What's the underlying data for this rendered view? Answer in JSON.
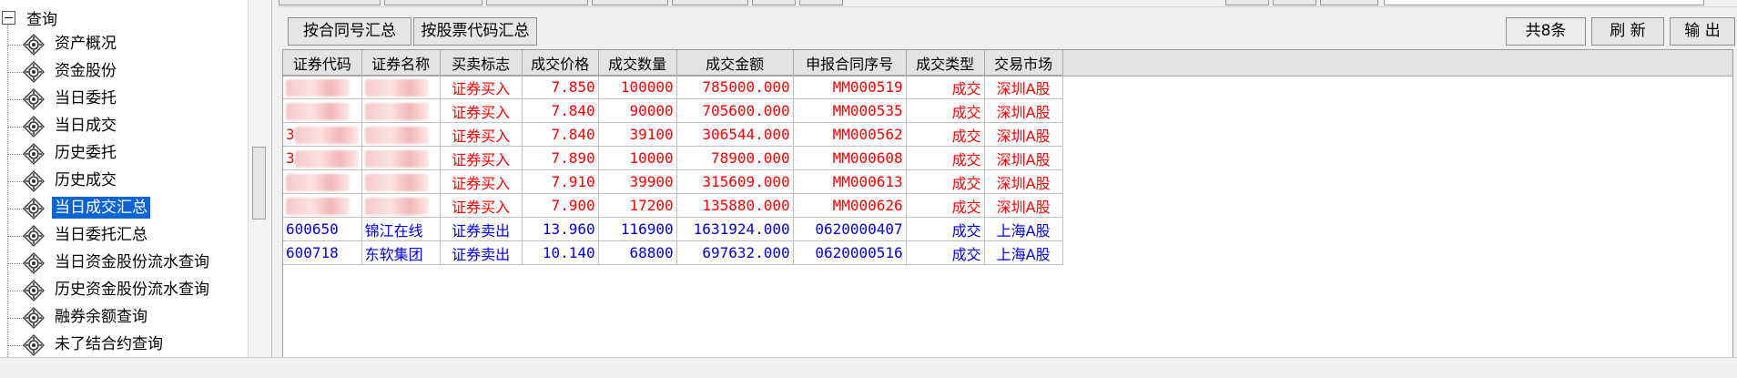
{
  "tree": {
    "root_label": "查询",
    "items": [
      {
        "label": "资产概况",
        "selected": false
      },
      {
        "label": "资金股份",
        "selected": false
      },
      {
        "label": "当日委托",
        "selected": false
      },
      {
        "label": "当日成交",
        "selected": false
      },
      {
        "label": "历史委托",
        "selected": false
      },
      {
        "label": "历史成交",
        "selected": false
      },
      {
        "label": "当日成交汇总",
        "selected": true
      },
      {
        "label": "当日委托汇总",
        "selected": false
      },
      {
        "label": "当日资金股份流水查询",
        "selected": false
      },
      {
        "label": "历史资金股份流水查询",
        "selected": false
      },
      {
        "label": "融券余额查询",
        "selected": false
      },
      {
        "label": "未了结合约查询",
        "selected": false
      }
    ]
  },
  "toolbar": {
    "group_by_contract": "按合同号汇总",
    "group_by_code": "按股票代码汇总",
    "count": "共8条",
    "refresh": "刷 新",
    "export": "输 出"
  },
  "table": {
    "columns": [
      "证券代码",
      "证券名称",
      "买卖标志",
      "成交价格",
      "成交数量",
      "成交金额",
      "申报合同序号",
      "成交类型",
      "交易市场"
    ],
    "rows": [
      {
        "code": "",
        "name": "",
        "side": "证券买入",
        "price": "7.850",
        "qty": "100000",
        "amount": "785000.000",
        "contract": "MM000519",
        "type": "成交",
        "market": "深圳A股",
        "color": "red",
        "redacted": true
      },
      {
        "code": "",
        "name": "",
        "side": "证券买入",
        "price": "7.840",
        "qty": "90000",
        "amount": "705600.000",
        "contract": "MM000535",
        "type": "成交",
        "market": "深圳A股",
        "color": "red",
        "redacted": true
      },
      {
        "code": "3",
        "name": "",
        "side": "证券买入",
        "price": "7.840",
        "qty": "39100",
        "amount": "306544.000",
        "contract": "MM000562",
        "type": "成交",
        "market": "深圳A股",
        "color": "red",
        "redacted": true
      },
      {
        "code": "3",
        "name": "",
        "side": "证券买入",
        "price": "7.890",
        "qty": "10000",
        "amount": "78900.000",
        "contract": "MM000608",
        "type": "成交",
        "market": "深圳A股",
        "color": "red",
        "redacted": true
      },
      {
        "code": "",
        "name": "",
        "side": "证券买入",
        "price": "7.910",
        "qty": "39900",
        "amount": "315609.000",
        "contract": "MM000613",
        "type": "成交",
        "market": "深圳A股",
        "color": "red",
        "redacted": true
      },
      {
        "code": "",
        "name": "",
        "side": "证券买入",
        "price": "7.900",
        "qty": "17200",
        "amount": "135880.000",
        "contract": "MM000626",
        "type": "成交",
        "market": "深圳A股",
        "color": "red",
        "redacted": true
      },
      {
        "code": "600650",
        "name": "锦江在线",
        "side": "证券卖出",
        "price": "13.960",
        "qty": "116900",
        "amount": "1631924.000",
        "contract": "0620000407",
        "type": "成交",
        "market": "上海A股",
        "color": "blue",
        "redacted": false
      },
      {
        "code": "600718",
        "name": "东软集团",
        "side": "证券卖出",
        "price": "10.140",
        "qty": "68800",
        "amount": "697632.000",
        "contract": "0620000516",
        "type": "成交",
        "market": "上海A股",
        "color": "blue",
        "redacted": false
      }
    ]
  },
  "colors": {
    "buy_text": "#ff0000",
    "sell_text": "#0000e0",
    "selection": "#0a64d6"
  },
  "icons": {
    "tree_node": "gear-diamond-icon",
    "collapse": "minus-box-icon"
  }
}
